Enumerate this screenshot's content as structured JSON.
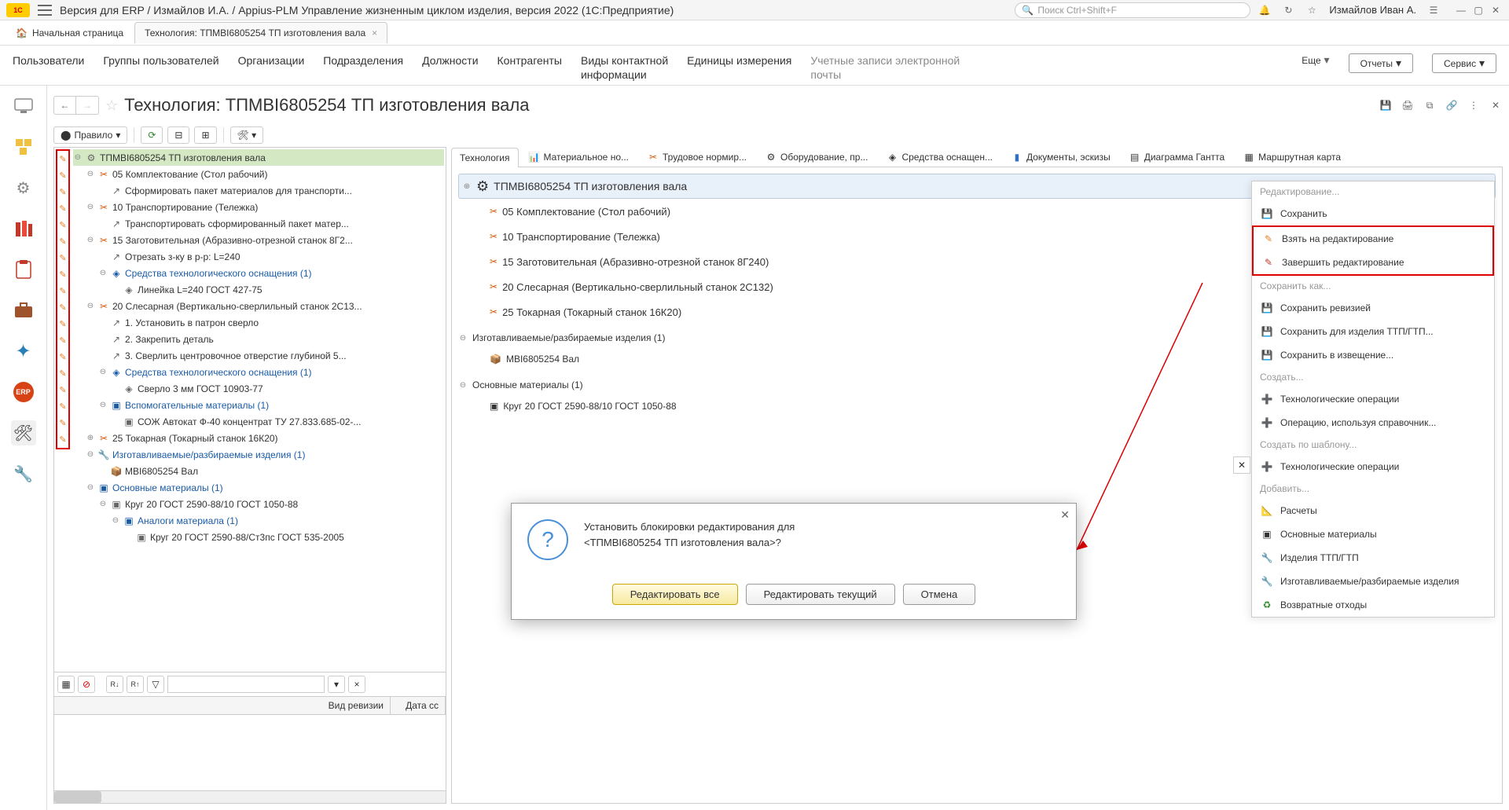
{
  "titlebar": {
    "app_title": "Версия для ERP / Измайлов И.А. / Appius-PLM Управление жизненным циклом изделия, версия 2022  (1С:Предприятие)",
    "search_placeholder": "Поиск Ctrl+Shift+F",
    "user": "Измайлов Иван А."
  },
  "tabs": {
    "home": "Начальная страница",
    "current": "Технология: ТПМВI6805254 ТП изготовления вала"
  },
  "sections": {
    "items": [
      "Пользователи",
      "Группы пользователей",
      "Организации",
      "Подразделения",
      "Должности",
      "Контрагенты",
      "Виды контактной\nинформации",
      "Единицы измерения",
      "Учетные записи электронной\nпочты"
    ],
    "more": "Еще",
    "reports": "Отчеты",
    "service": "Сервис"
  },
  "page": {
    "title": "Технология: ТПМВI6805254 ТП изготовления вала"
  },
  "toolbar": {
    "rule": "Правило"
  },
  "tree": [
    {
      "ind": 0,
      "sel": true,
      "tog": "−",
      "icon": "⚙",
      "label": "ТПМВI6805254 ТП изготовления вала"
    },
    {
      "ind": 1,
      "tog": "−",
      "icon": "✂",
      "col": "#d35400",
      "label": "05 Комплектование (Стол рабочий)"
    },
    {
      "ind": 2,
      "icon": "↗",
      "label": "Сформировать пакет материалов для транспорти..."
    },
    {
      "ind": 1,
      "tog": "−",
      "icon": "✂",
      "col": "#d35400",
      "label": "10 Транспортирование (Тележка)"
    },
    {
      "ind": 2,
      "icon": "↗",
      "label": "Транспортировать сформированный пакет матер..."
    },
    {
      "ind": 1,
      "tog": "−",
      "icon": "✂",
      "col": "#d35400",
      "label": "15 Заготовительная (Абразивно-отрезной станок 8Г2..."
    },
    {
      "ind": 2,
      "icon": "↗",
      "label": "Отрезать з-ку в р-р: L=240"
    },
    {
      "ind": 2,
      "tog": "−",
      "icon": "◈",
      "col": "#1a5ba8",
      "label": "Средства технологического оснащения (1)",
      "blue": true
    },
    {
      "ind": 3,
      "icon": "◈",
      "label": "Линейка L=240  ГОСТ 427-75"
    },
    {
      "ind": 1,
      "tog": "−",
      "icon": "✂",
      "col": "#d35400",
      "label": "20 Слесарная (Вертикально-сверлильный станок 2С13..."
    },
    {
      "ind": 2,
      "icon": "↗",
      "label": "1. Установить в патрон сверло"
    },
    {
      "ind": 2,
      "icon": "↗",
      "label": "2. Закрепить деталь"
    },
    {
      "ind": 2,
      "icon": "↗",
      "label": "3. Сверлить центровочное отверстие глубиной 5..."
    },
    {
      "ind": 2,
      "tog": "−",
      "icon": "◈",
      "col": "#1a5ba8",
      "label": "Средства технологического оснащения (1)",
      "blue": true
    },
    {
      "ind": 3,
      "icon": "◈",
      "label": "Сверло 3 мм  ГОСТ 10903-77"
    },
    {
      "ind": 2,
      "tog": "−",
      "icon": "▣",
      "col": "#1a5ba8",
      "label": "Вспомогательные материалы (1)",
      "blue": true
    },
    {
      "ind": 3,
      "icon": "▣",
      "label": "СОЖ Автокат Ф-40 концентрат ТУ 27.833.685-02-..."
    },
    {
      "ind": 1,
      "tog": "+",
      "icon": "✂",
      "col": "#d35400",
      "label": "25 Токарная (Токарный станок 16К20)"
    },
    {
      "ind": 1,
      "tog": "−",
      "icon": "🔧",
      "col": "#1a5ba8",
      "label": "Изготавливаемые/разбираемые изделия (1)",
      "blue": true
    },
    {
      "ind": 2,
      "icon": "📦",
      "label": "МВI6805254 Вал"
    },
    {
      "ind": 1,
      "tog": "−",
      "icon": "▣",
      "col": "#1a5ba8",
      "label": "Основные материалы (1)",
      "blue": true
    },
    {
      "ind": 2,
      "tog": "−",
      "icon": "▣",
      "label": "Круг 20 ГОСТ 2590-88/10 ГОСТ 1050-88"
    },
    {
      "ind": 3,
      "tog": "−",
      "icon": "▣",
      "col": "#1a5ba8",
      "label": "Аналоги материала (1)",
      "blue": true
    },
    {
      "ind": 4,
      "icon": "▣",
      "label": "Круг 20 ГОСТ 2590-88/Ст3пс ГОСТ 535-2005"
    }
  ],
  "revision": {
    "col1": "Вид ревизии",
    "col2": "Дата сс"
  },
  "detail_tabs": [
    "Технология",
    "Материальное но...",
    "Трудовое нормир...",
    "Оборудование, пр...",
    "Средства оснащен...",
    "Документы, эскизы",
    "Диаграмма Гантта",
    "Маршрутная карта"
  ],
  "detail": {
    "header": "ТПМВI6805254 ТП изготовления вала",
    "ops": [
      "05 Комплектование (Стол рабочий)",
      "10 Транспортирование (Тележка)",
      "15 Заготовительная (Абразивно-отрезной станок 8Г240)",
      "20 Слесарная (Вертикально-сверлильный станок 2С132)",
      "25 Токарная (Токарный станок 16К20)"
    ],
    "sec1": "Изготавливаемые/разбираемые изделия (1)",
    "it1": "МВI6805254 Вал",
    "sec2": "Основные материалы (1)",
    "it2": "Круг 20 ГОСТ 2590-88/10 ГОСТ 1050-88"
  },
  "dialog": {
    "text": "Установить блокировки редактирования для\n<ТПМВI6805254 ТП изготовления вала>?",
    "btn1": "Редактировать все",
    "btn2": "Редактировать текущий",
    "btn3": "Отмена"
  },
  "side_panel": {
    "s1": "Редактирование...",
    "save": "Сохранить",
    "take": "Взять на редактирование",
    "finish": "Завершить редактирование",
    "s2": "Сохранить как...",
    "rev": "Сохранить ревизией",
    "ttp": "Сохранить для изделия ТТП/ГТП...",
    "notice": "Сохранить в извещение...",
    "s3": "Создать...",
    "techop": "Технологические операции",
    "opref": "Операцию, используя справочник...",
    "s4": "Создать по шаблону...",
    "techop2": "Технологические операции",
    "s5": "Добавить...",
    "calc": "Расчеты",
    "mat": "Основные материалы",
    "ttpgtp": "Изделия ТТП/ГТП",
    "manuf": "Изготавливаемые/разбираемые изделия",
    "waste": "Возвратные отходы"
  }
}
